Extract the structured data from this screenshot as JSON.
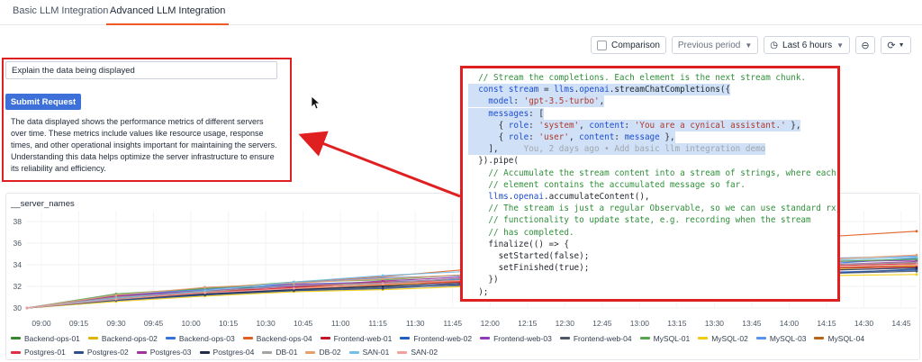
{
  "tabs": [
    {
      "label": "Basic LLM Integration",
      "active": false
    },
    {
      "label": "Advanced LLM Integration",
      "active": true
    }
  ],
  "toolbar": {
    "comparison_label": "Comparison",
    "previous_period": "Previous period",
    "time_range": "Last 6 hours",
    "zoom_icon": "zoom-out-icon",
    "refresh_icon": "refresh-icon"
  },
  "prompt": {
    "value": "Explain the data being displayed",
    "submit_label": "Submit Request",
    "response": "The data displayed shows the performance metrics of different servers over time. These metrics include values like resource usage, response times, and other operational insights important for maintaining the servers. Understanding this data helps optimize the server infrastructure to ensure its reliability and efficiency."
  },
  "code": {
    "lines": [
      {
        "text": "  // Stream the completions. Each element is the next stream chunk.",
        "kind": "cm",
        "selected": false
      },
      {
        "text": "  const stream = llms.openai.streamChatCompletions({",
        "kind": "pl",
        "selected": true
      },
      {
        "text": "    model: 'gpt-3.5-turbo',",
        "kind": "pl",
        "selected": true
      },
      {
        "text": "    messages: [",
        "kind": "pl",
        "selected": true
      },
      {
        "text": "      { role: 'system', content: 'You are a cynical assistant.' },",
        "kind": "pl",
        "selected": true
      },
      {
        "text": "      { role: 'user', content: message },",
        "kind": "pl",
        "selected": true
      },
      {
        "text": "    ],",
        "kind": "pl",
        "selected": true
      },
      {
        "text": "  }).pipe(",
        "kind": "pl",
        "selected": false
      },
      {
        "text": "    // Accumulate the stream content into a stream of strings, where each",
        "kind": "cm",
        "selected": false
      },
      {
        "text": "    // element contains the accumulated message so far.",
        "kind": "cm",
        "selected": false
      },
      {
        "text": "    llms.openai.accumulateContent(),",
        "kind": "pl",
        "selected": false
      },
      {
        "text": "    // The stream is just a regular Observable, so we can use standard rxjs",
        "kind": "cm",
        "selected": false
      },
      {
        "text": "    // functionality to update state, e.g. recording when the stream",
        "kind": "cm",
        "selected": false
      },
      {
        "text": "    // has completed.",
        "kind": "cm",
        "selected": false
      },
      {
        "text": "    finalize(() => {",
        "kind": "pl",
        "selected": false
      },
      {
        "text": "      setStarted(false);",
        "kind": "pl",
        "selected": false
      },
      {
        "text": "      setFinished(true);",
        "kind": "pl",
        "selected": false
      },
      {
        "text": "    })",
        "kind": "pl",
        "selected": false
      },
      {
        "text": "  );",
        "kind": "pl",
        "selected": false
      }
    ],
    "blame": "You, 2 days ago • Add basic llm integration demo"
  },
  "chart_panel_title": "__server_names",
  "chart_data": {
    "type": "line",
    "yticks": [
      30,
      32,
      34,
      36,
      38
    ],
    "ylim": [
      30,
      39
    ],
    "xticks": [
      "09:00",
      "09:15",
      "09:30",
      "09:45",
      "10:00",
      "10:15",
      "10:30",
      "10:45",
      "11:00",
      "11:15",
      "11:30",
      "11:45",
      "12:00",
      "12:15",
      "12:30",
      "12:45",
      "13:00",
      "13:15",
      "13:30",
      "13:45",
      "14:00",
      "14:15",
      "14:30",
      "14:45"
    ],
    "series": [
      {
        "name": "Backend-ops-01",
        "color": "#37872d",
        "values": [
          30.0,
          31.0,
          31.8,
          32.0,
          32.3,
          32.6,
          33.0,
          33.2,
          33.6,
          34.0,
          34.2
        ]
      },
      {
        "name": "Backend-ops-02",
        "color": "#e0b400",
        "values": [
          30.0,
          30.8,
          31.4,
          31.9,
          32.1,
          32.5,
          32.8,
          33.1,
          33.3,
          33.6,
          33.9
        ]
      },
      {
        "name": "Backend-ops-03",
        "color": "#3274d9",
        "values": [
          30.0,
          31.2,
          31.5,
          32.2,
          32.4,
          32.7,
          33.2,
          33.5,
          33.8,
          34.1,
          34.6
        ]
      },
      {
        "name": "Backend-ops-04",
        "color": "#e05f20",
        "values": [
          30.0,
          30.9,
          31.7,
          32.4,
          32.9,
          33.6,
          34.3,
          35.1,
          35.9,
          36.6,
          37.1
        ]
      },
      {
        "name": "Frontend-web-01",
        "color": "#c4162a",
        "values": [
          30.0,
          31.1,
          31.6,
          31.8,
          32.2,
          32.4,
          32.9,
          33.0,
          33.4,
          33.7,
          33.8
        ]
      },
      {
        "name": "Frontend-web-02",
        "color": "#1f60c4",
        "values": [
          30.0,
          30.7,
          31.3,
          31.7,
          32.0,
          32.3,
          32.6,
          32.9,
          33.1,
          33.3,
          33.5
        ]
      },
      {
        "name": "Frontend-web-03",
        "color": "#8f3bb8",
        "values": [
          30.0,
          31.0,
          31.9,
          32.2,
          32.3,
          32.8,
          33.1,
          33.6,
          33.9,
          34.3,
          34.4
        ]
      },
      {
        "name": "Frontend-web-04",
        "color": "#4f5867",
        "values": [
          30.0,
          30.8,
          31.2,
          31.6,
          31.9,
          32.1,
          32.5,
          32.7,
          32.9,
          33.2,
          33.4
        ]
      },
      {
        "name": "MySQL-01",
        "color": "#56a64b",
        "values": [
          30.0,
          31.3,
          31.8,
          32.4,
          32.6,
          33.1,
          33.3,
          33.7,
          34.0,
          34.3,
          34.5
        ]
      },
      {
        "name": "MySQL-02",
        "color": "#f2cc0c",
        "values": [
          30.0,
          30.6,
          31.1,
          31.5,
          31.7,
          32.0,
          32.2,
          32.6,
          32.8,
          33.0,
          33.1
        ]
      },
      {
        "name": "MySQL-03",
        "color": "#5794f2",
        "values": [
          30.0,
          31.2,
          31.7,
          32.3,
          32.8,
          33.0,
          33.4,
          33.9,
          34.1,
          34.6,
          34.8
        ]
      },
      {
        "name": "MySQL-04",
        "color": "#b8651a",
        "values": [
          30.0,
          30.9,
          31.5,
          31.8,
          32.1,
          32.6,
          32.8,
          33.1,
          33.5,
          33.7,
          34.0
        ]
      },
      {
        "name": "Postgres-01",
        "color": "#e02f44",
        "values": [
          30.0,
          31.0,
          31.4,
          31.9,
          32.4,
          32.5,
          33.0,
          33.3,
          33.5,
          33.9,
          34.1
        ]
      },
      {
        "name": "Postgres-02",
        "color": "#2f4f8f",
        "values": [
          30.0,
          30.7,
          31.2,
          31.6,
          31.8,
          32.2,
          32.4,
          32.8,
          33.0,
          33.2,
          33.6
        ]
      },
      {
        "name": "Postgres-03",
        "color": "#a0339e",
        "values": [
          30.0,
          31.1,
          31.6,
          32.0,
          32.5,
          32.9,
          33.2,
          33.4,
          33.8,
          34.0,
          34.3
        ]
      },
      {
        "name": "Postgres-04",
        "color": "#242c4c",
        "values": [
          30.0,
          30.8,
          31.3,
          31.7,
          32.0,
          32.3,
          32.7,
          32.9,
          33.2,
          33.5,
          33.7
        ]
      },
      {
        "name": "DB-01",
        "color": "#a3a3a3",
        "values": [
          30.0,
          31.0,
          31.5,
          32.1,
          32.3,
          32.8,
          33.1,
          33.2,
          33.6,
          34.0,
          34.2
        ]
      },
      {
        "name": "DB-02",
        "color": "#e5a06c",
        "values": [
          30.0,
          31.2,
          31.9,
          32.3,
          32.7,
          33.1,
          33.5,
          33.8,
          34.2,
          34.5,
          34.9
        ]
      },
      {
        "name": "SAN-01",
        "color": "#73bfe8",
        "values": [
          30.0,
          30.9,
          31.6,
          32.4,
          33.0,
          33.4,
          34.0,
          34.3,
          33.8,
          34.4,
          34.7
        ]
      },
      {
        "name": "SAN-02",
        "color": "#f4a09b",
        "values": [
          30.0,
          30.8,
          31.4,
          31.8,
          32.2,
          32.6,
          32.9,
          33.2,
          33.4,
          33.8,
          34.0
        ]
      }
    ]
  }
}
